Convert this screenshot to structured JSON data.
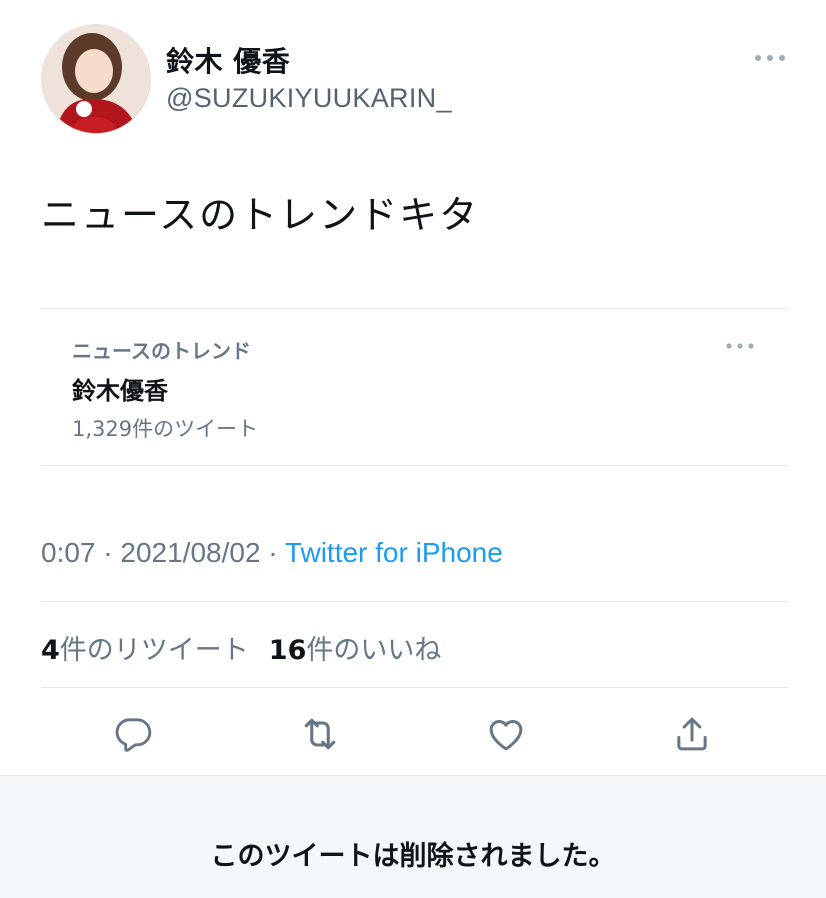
{
  "user": {
    "name": "鈴木 優香",
    "handle": "@SUZUKIYUUKARIN_"
  },
  "tweet": {
    "text": "ニュースのトレンドキタ"
  },
  "trend_card": {
    "context": "ニュースのトレンド",
    "title": "鈴木優香",
    "count": "1,329件のツイート"
  },
  "meta": {
    "time": "0:07",
    "separator": " · ",
    "date": "2021/08/02",
    "source": "Twitter for iPhone"
  },
  "stats": {
    "retweets_count": "4",
    "retweets_label": "件のリツイート",
    "likes_count": "16",
    "likes_label": "件のいいね"
  },
  "actions": {
    "icons": [
      "reply-icon",
      "retweet-icon",
      "like-icon",
      "share-icon"
    ]
  },
  "notice": {
    "deleted_text": "このツイートは削除されました。"
  },
  "colors": {
    "accent": "#1d9bf0",
    "secondary_text": "#657786",
    "divider": "#e1e8ed",
    "notice_bg": "#f5f8fa"
  }
}
